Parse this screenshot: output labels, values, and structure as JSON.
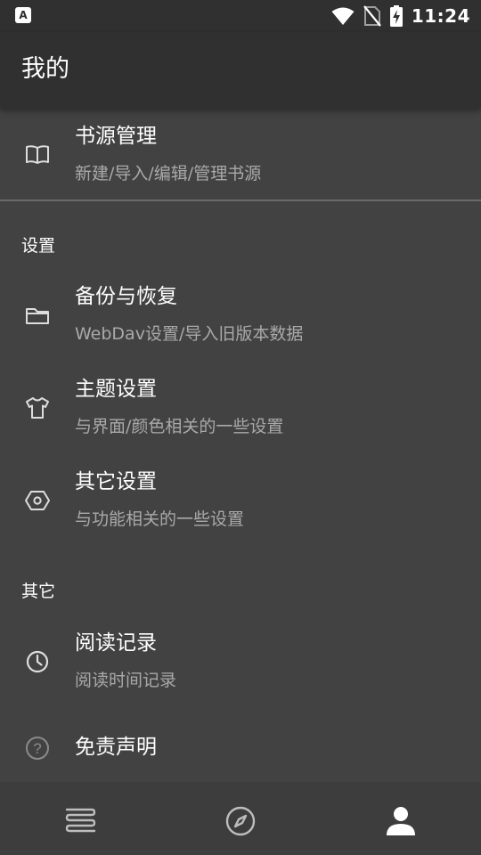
{
  "status_bar": {
    "app_badge": "A",
    "time": "11:24"
  },
  "app_bar": {
    "title": "我的"
  },
  "top_item": {
    "title": "书源管理",
    "subtitle": "新建/导入/编辑/管理书源",
    "icon": "book-open-icon"
  },
  "settings": {
    "header": "设置",
    "items": [
      {
        "title": "备份与恢复",
        "subtitle": "WebDav设置/导入旧版本数据",
        "icon": "folder-icon"
      },
      {
        "title": "主题设置",
        "subtitle": "与界面/颜色相关的一些设置",
        "icon": "shirt-icon"
      },
      {
        "title": "其它设置",
        "subtitle": "与功能相关的一些设置",
        "icon": "hexagon-settings-icon"
      }
    ]
  },
  "others": {
    "header": "其它",
    "items": [
      {
        "title": "阅读记录",
        "subtitle": "阅读时间记录",
        "icon": "clock-icon"
      },
      {
        "title": "免责声明",
        "icon": "help-circle-icon"
      }
    ]
  },
  "bottom_nav": {
    "items": [
      {
        "icon": "bookshelf-icon",
        "active": false
      },
      {
        "icon": "compass-icon",
        "active": false
      },
      {
        "icon": "person-icon",
        "active": true
      }
    ]
  },
  "colors": {
    "background": "#424242",
    "app_bar": "#303030",
    "bottom_nav": "#3d3d3d",
    "secondary_text": "#a9a9a9",
    "active_icon": "#ffffff",
    "inactive_icon": "#bdbdbd"
  }
}
